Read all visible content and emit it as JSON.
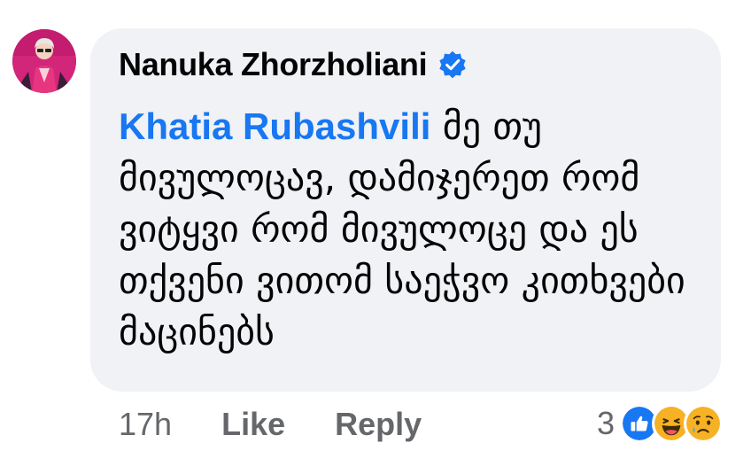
{
  "comment": {
    "avatar_icon": "user-avatar-icon",
    "author": "Nanuka Zhorzholiani",
    "verified_icon": "verified-badge-icon",
    "mention": "Khatia Rubashvili",
    "lines": [
      "მე თუ",
      "მივულოცავ, დამიჯერეთ",
      "რომ ვიტყვი რომ მივულოცე",
      "და ეს თქვენი ვითომ",
      "საეჭვო კითხვები მაცინებს"
    ]
  },
  "actions": {
    "time": "17h",
    "like_label": "Like",
    "reply_label": "Reply"
  },
  "reactions": {
    "count": "3",
    "icons": [
      "like-reaction-icon",
      "haha-reaction-icon",
      "sad-reaction-icon"
    ]
  },
  "colors": {
    "bubble": "#f0f2f5",
    "mention": "#1877f2",
    "secondary_text": "#65676b"
  }
}
